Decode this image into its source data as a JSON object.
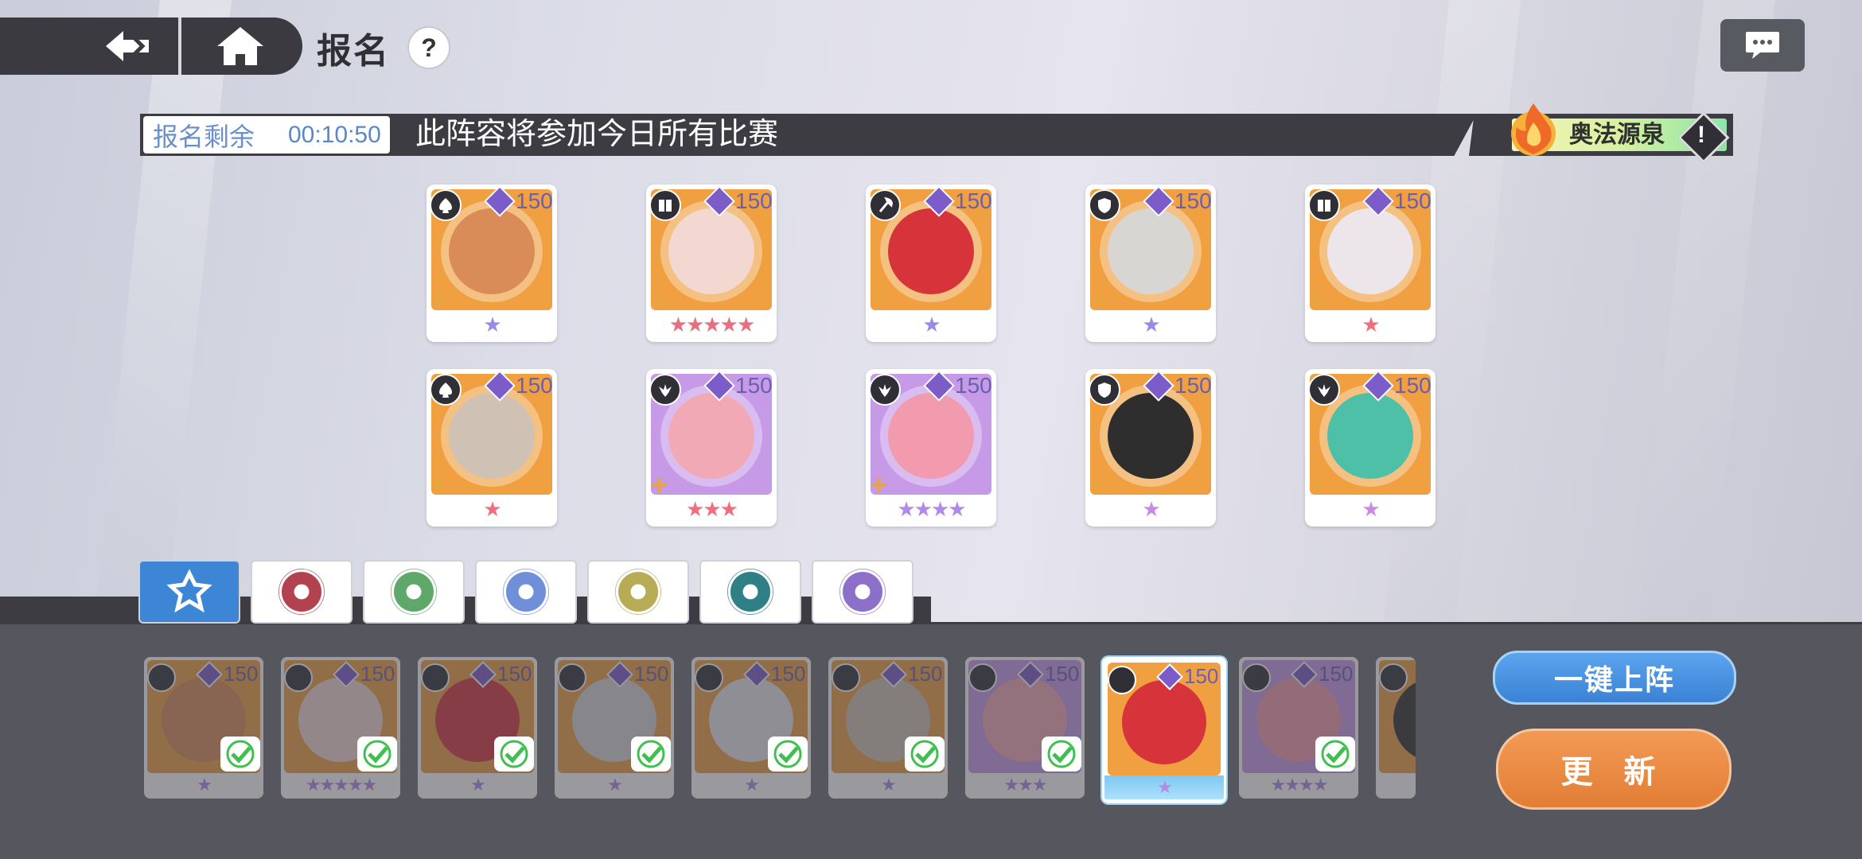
{
  "header": {
    "title": "报名",
    "help_icon": "?"
  },
  "banner": {
    "timer_label": "报名剩余",
    "timer_value": "00:10:50",
    "message": "此阵容将参加今日所有比赛",
    "spring_label": "奥法源泉",
    "alert_icon": "!"
  },
  "lineup": [
    {
      "level": "150",
      "stars": "★",
      "stars_color": "#9a8ae6",
      "ring": "#f0a040",
      "face": "#d98b58",
      "class": "spade"
    },
    {
      "level": "150",
      "stars": "★★★★★",
      "stars_color": "#e8707e",
      "ring": "#f0a040",
      "face": "#f2d8d0",
      "class": "book"
    },
    {
      "level": "150",
      "stars": "★",
      "stars_color": "#9a8ae6",
      "ring": "#f0a040",
      "face": "#d6343a",
      "class": "axe"
    },
    {
      "level": "150",
      "stars": "★",
      "stars_color": "#9a8ae6",
      "ring": "#f0a040",
      "face": "#d8d6d2",
      "class": "shield"
    },
    {
      "level": "150",
      "stars": "★",
      "stars_color": "#ef6f7e",
      "ring": "#f0a040",
      "face": "#ece6ea",
      "class": "book"
    },
    {
      "level": "150",
      "stars": "★",
      "stars_color": "#ef6f7e",
      "ring": "#f0a040",
      "face": "#cfc2b4",
      "class": "spade"
    },
    {
      "level": "150",
      "stars": "★★★",
      "stars_color": "#ef6f7e",
      "ring": "#c79ae8",
      "face": "#f2a9b6",
      "class": "wing"
    },
    {
      "level": "150",
      "stars": "★★★★",
      "stars_color": "#b08ae6",
      "ring": "#c79ae8",
      "face": "#f29aae",
      "class": "wing"
    },
    {
      "level": "150",
      "stars": "★",
      "stars_color": "#c78ae6",
      "ring": "#f0a040",
      "face": "#2e2e2e",
      "class": "shield"
    },
    {
      "level": "150",
      "stars": "★",
      "stars_color": "#c78ae6",
      "ring": "#f0a040",
      "face": "#4fc0a8",
      "class": "wing"
    }
  ],
  "faction_tabs": [
    {
      "name": "all",
      "color": "#ffffff",
      "active": true
    },
    {
      "name": "fire",
      "color": "#b2424f",
      "active": false
    },
    {
      "name": "nature",
      "color": "#5ea86a",
      "active": false
    },
    {
      "name": "star",
      "color": "#6f8fd8",
      "active": false
    },
    {
      "name": "holy",
      "color": "#b7ab55",
      "active": false
    },
    {
      "name": "abyss",
      "color": "#2e7f86",
      "active": false
    },
    {
      "name": "eye",
      "color": "#8b6fc8",
      "active": false
    }
  ],
  "roster": [
    {
      "level": "150",
      "stars": "★",
      "face": "#d98b58",
      "ring": "#f0a040",
      "checked": true,
      "selected": false
    },
    {
      "level": "150",
      "stars": "★★★★★",
      "face": "#f2d8d0",
      "ring": "#f0a040",
      "checked": true,
      "selected": false
    },
    {
      "level": "150",
      "stars": "★",
      "face": "#d6343a",
      "ring": "#f0a040",
      "checked": true,
      "selected": false
    },
    {
      "level": "150",
      "stars": "★",
      "face": "#d8d6d2",
      "ring": "#f0a040",
      "checked": true,
      "selected": false
    },
    {
      "level": "150",
      "stars": "★",
      "face": "#ece6ea",
      "ring": "#f0a040",
      "checked": true,
      "selected": false
    },
    {
      "level": "150",
      "stars": "★",
      "face": "#cfc2b4",
      "ring": "#f0a040",
      "checked": true,
      "selected": false
    },
    {
      "level": "150",
      "stars": "★★★",
      "face": "#f2a9b6",
      "ring": "#c79ae8",
      "checked": true,
      "selected": false
    },
    {
      "level": "150",
      "stars": "★",
      "face": "#d6343a",
      "ring": "#f0a040",
      "checked": false,
      "selected": true
    },
    {
      "level": "150",
      "stars": "★★★★",
      "face": "#f29aae",
      "ring": "#c79ae8",
      "checked": true,
      "selected": false
    },
    {
      "level": "",
      "stars": "",
      "face": "#2e2e2e",
      "ring": "#f0a040",
      "checked": false,
      "selected": false
    }
  ],
  "buttons": {
    "quick_deploy": "一键上阵",
    "update": "更 新"
  }
}
